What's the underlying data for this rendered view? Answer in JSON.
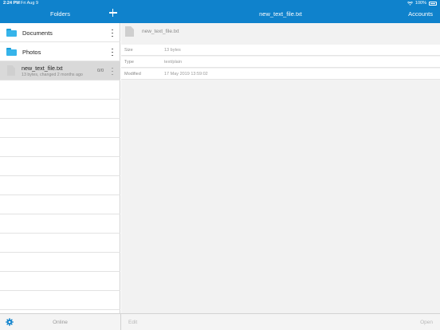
{
  "status": {
    "time": "2:24 PM",
    "date": "Fri Aug 9",
    "battery": "100%"
  },
  "nav": {
    "folders_title": "Folders",
    "file_title": "new_text_file.txt",
    "accounts_label": "Accounts"
  },
  "sidebar": {
    "items": [
      {
        "type": "folder",
        "label": "Documents"
      },
      {
        "type": "folder",
        "label": "Photos"
      },
      {
        "type": "file",
        "label": "new_text_file.txt",
        "subtitle": "13 bytes, changed 2 months ago",
        "count": "0/0"
      }
    ]
  },
  "detail": {
    "file_name": "new_text_file.txt",
    "properties": [
      {
        "key": "Size",
        "value": "13 bytes"
      },
      {
        "key": "Type",
        "value": "text/plain"
      },
      {
        "key": "Modified",
        "value": "17 May 2019 13:59:02"
      }
    ]
  },
  "bottom": {
    "status_label": "Online",
    "edit_label": "Edit",
    "open_label": "Open"
  },
  "colors": {
    "accent": "#0f82cc",
    "folder": "#36b4ea",
    "selected_row": "#d9d9d9"
  },
  "icons": [
    "wifi-icon",
    "battery-icon",
    "add-icon",
    "folder-icon",
    "file-icon",
    "more-icon",
    "gear-icon"
  ]
}
